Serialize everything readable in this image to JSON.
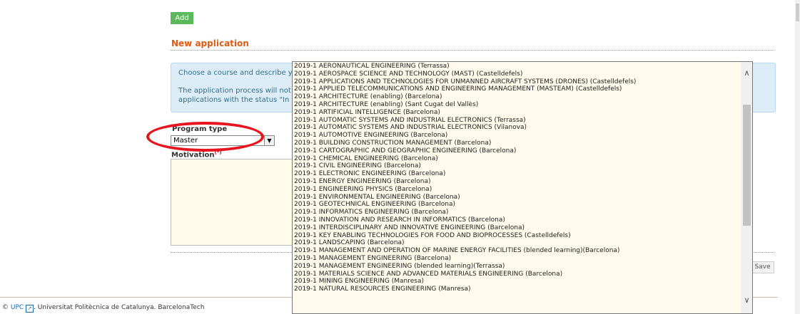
{
  "toolbar": {
    "add_label": "Add"
  },
  "form": {
    "title": "New application",
    "info_line1": "Choose a course and describe yo",
    "info_line2": "The application process will not l",
    "info_line3": "applications with the status \"In p",
    "program_type_label": "Program type",
    "program_type_value": "Master",
    "motivation_label": "Motivation",
    "motivation_marker": "(*)",
    "save_label": "Save"
  },
  "course_dropdown": {
    "options": [
      "2019-1 AERONAUTICAL ENGINEERING (Terrassa)",
      "2019-1 AEROSPACE SCIENCE AND TECHNOLOGY (MAST) (Castelldefels)",
      "2019-1 APPLICATIONS AND TECHNOLOGIES FOR UNMANNED AIRCRAFT SYSTEMS (DRONES) (Castelldefels)",
      "2019-1 APPLIED TELECOMMUNICATIONS AND ENGINEERING MANAGEMENT (MASTEAM) (Castelldefels)",
      "2019-1 ARCHITECTURE (enabling) (Barcelona)",
      "2019-1 ARCHITECTURE (enabling) (Sant Cugat del Vallès)",
      "2019-1 ARTIFICIAL INTELLIGENCE (Barcelona)",
      "2019-1 AUTOMATIC SYSTEMS AND INDUSTRIAL ELECTRONICS (Terrassa)",
      "2019-1 AUTOMATIC SYSTEMS AND INDUSTRIAL ELECTRONICS (Vilanova)",
      "2019-1 AUTOMOTIVE ENGINEERING (Barcelona)",
      "2019-1 BUILDING CONSTRUCTION MANAGEMENT (Barcelona)",
      "2019-1 CARTOGRAPHIC AND GEOGRAPHIC ENGINEERING (Barcelona)",
      "2019-1 CHEMICAL ENGINEERING (Barcelona)",
      "2019-1 CIVIL ENGINEERING (Barcelona)",
      "2019-1 ELECTRONIC ENGINEERING (Barcelona)",
      "2019-1 ENERGY ENGINEERING (Barcelona)",
      "2019-1 ENGINEERING PHYSICS (Barcelona)",
      "2019-1 ENVIRONMENTAL ENGINEERING (Barcelona)",
      "2019-1 GEOTECHNICAL ENGINEERING (Barcelona)",
      "2019-1 INFORMATICS ENGINEERING (Barcelona)",
      "2019-1 INNOVATION AND RESEARCH IN INFORMATICS (Barcelona)",
      "2019-1 INTERDISCIPLINARY AND INNOVATIVE ENGINEERING (Barcelona)",
      "2019-1 KEY ENABLING TECHNOLOGIES FOR FOOD AND BIOPROCESSES (Castelldefels)",
      "2019-1 LANDSCAPING (Barcelona)",
      "2019-1 MANAGEMENT AND OPERATION OF MARINE ENERGY FACILITIES (blended learning)(Barcelona)",
      "2019-1 MANAGEMENT ENGINEERING (Barcelona)",
      "2019-1 MANAGEMENT ENGINEERING (blended learning)(Terrassa)",
      "2019-1 MATERIALS SCIENCE AND ADVANCED MATERIALS ENGINEERING (Barcelona)",
      "2019-1 MINING ENGINEERING (Manresa)",
      "2019-1 NATURAL RESOURCES ENGINEERING (Manresa)"
    ]
  },
  "footer": {
    "copyright": "©",
    "upc_link": "UPC",
    "external_icon": "external-link-icon",
    "text": ". Universitat Politècnica de Catalunya. BarcelonaTech"
  },
  "colors": {
    "add_button": "#5cb85c",
    "title": "#e05a12",
    "info_bg": "#dcedf7",
    "dropdown_bg": "#fffaeb",
    "annotation_oval": "#e8131c"
  }
}
